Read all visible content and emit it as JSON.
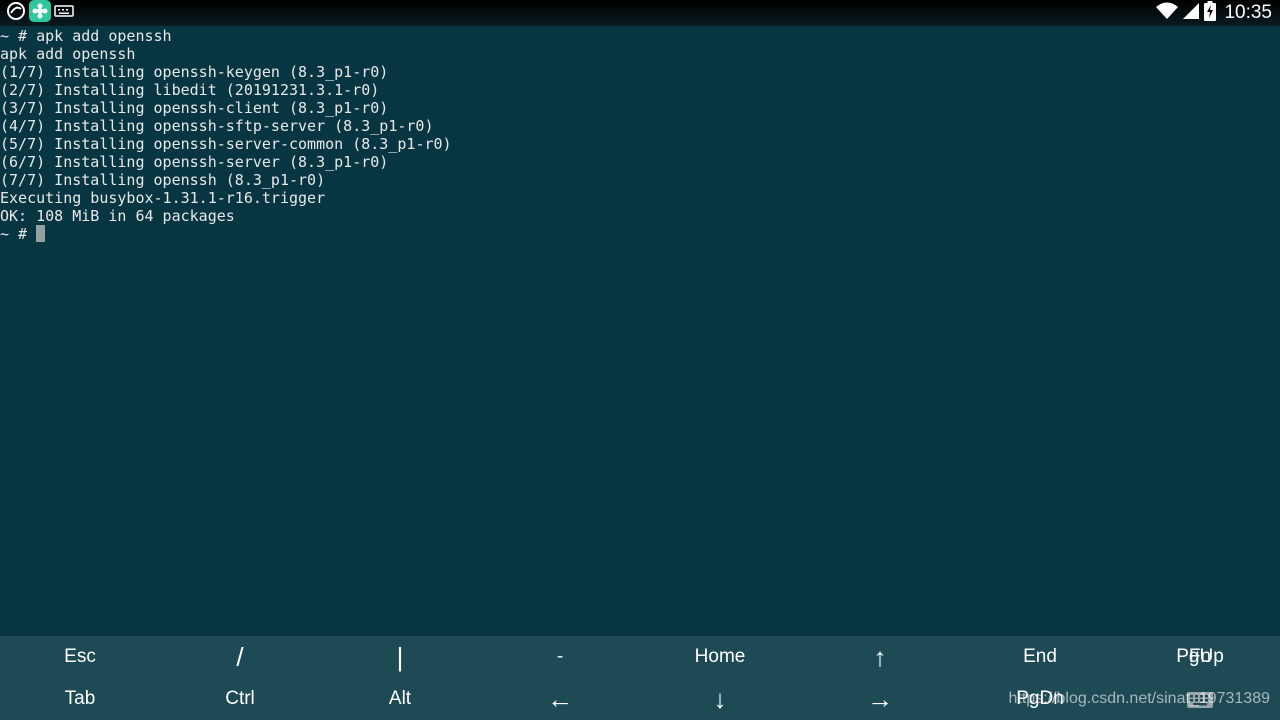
{
  "status_bar": {
    "time": "10:35",
    "left_icons": [
      "app-icon",
      "flower-app-icon",
      "keyboard-notification-icon"
    ],
    "right_icons": [
      "wifi-icon",
      "signal-icon",
      "battery-charging-icon"
    ]
  },
  "terminal": {
    "lines": [
      "~ # apk add openssh",
      "apk add openssh",
      "(1/7) Installing openssh-keygen (8.3_p1-r0)",
      "(2/7) Installing libedit (20191231.3.1-r0)",
      "(3/7) Installing openssh-client (8.3_p1-r0)",
      "(4/7) Installing openssh-sftp-server (8.3_p1-r0)",
      "(5/7) Installing openssh-server-common (8.3_p1-r0)",
      "(6/7) Installing openssh-server (8.3_p1-r0)",
      "(7/7) Installing openssh (8.3_p1-r0)",
      "Executing busybox-1.31.1-r16.trigger",
      "OK: 108 MiB in 64 packages"
    ],
    "prompt": "~ # "
  },
  "extra_keys": {
    "row1": [
      "Esc",
      "/",
      "|",
      "-",
      "Home",
      "↑",
      "End",
      "PgUp",
      "Fn"
    ],
    "row2": [
      "Tab",
      "Ctrl",
      "Alt",
      "←",
      "↓",
      "→",
      "PgDn"
    ]
  },
  "watermark": "https://blog.csdn.net/sinat_19731389",
  "colors": {
    "terminal_bg": "#073642",
    "extra_keys_bg": "#1e4a55",
    "cursor": "#93a1a1"
  }
}
